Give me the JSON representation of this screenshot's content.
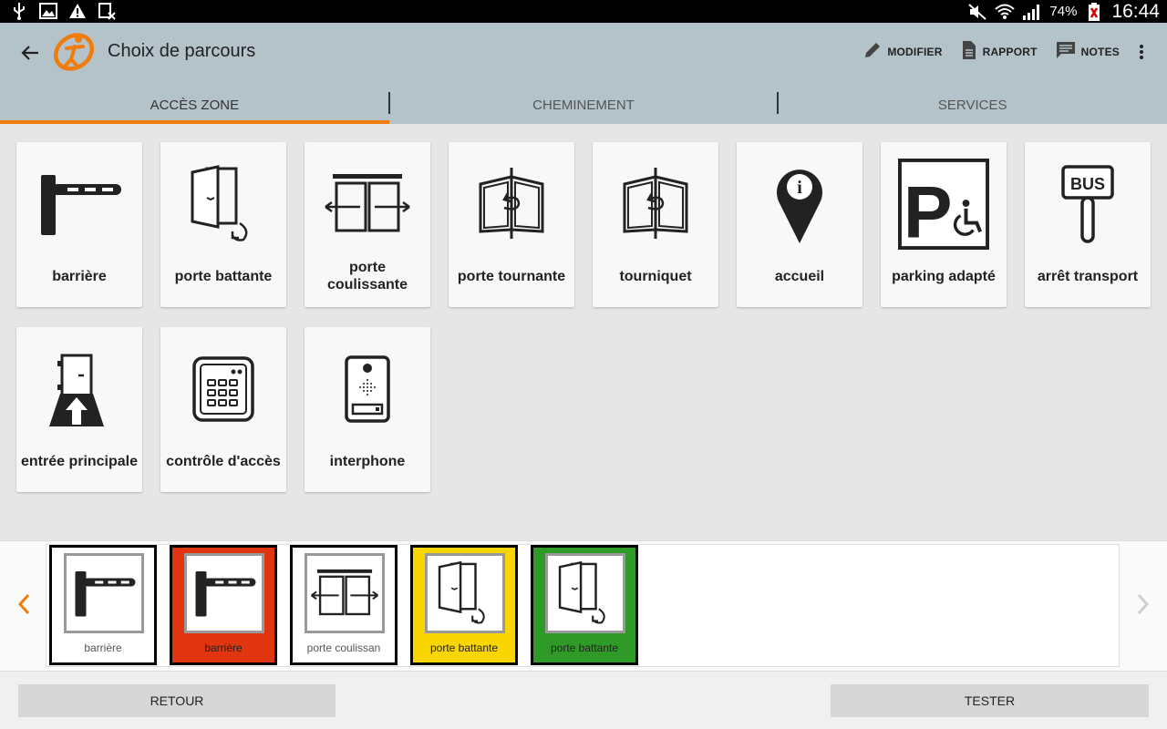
{
  "status_bar": {
    "left_icons": [
      "usb-icon",
      "image-icon",
      "warning-icon",
      "sim-icon"
    ],
    "right_icons": [
      "mute-icon",
      "wifi-icon",
      "signal-icon",
      "battery-icon"
    ],
    "battery": "74%",
    "time": "16:44"
  },
  "header": {
    "title": "Choix de parcours",
    "actions": [
      {
        "label": "MODIFIER",
        "icon": "pencil-icon"
      },
      {
        "label": "RAPPORT",
        "icon": "document-icon"
      },
      {
        "label": "NOTES",
        "icon": "notes-icon"
      }
    ]
  },
  "tabs": [
    {
      "label": "ACCÈS ZONE",
      "active": true
    },
    {
      "label": "CHEMINEMENT",
      "active": false
    },
    {
      "label": "SERVICES",
      "active": false
    }
  ],
  "cards": [
    {
      "label": "barrière",
      "icon": "barrier-icon"
    },
    {
      "label": "porte battante",
      "icon": "swing-door-icon"
    },
    {
      "label": "porte coulissante",
      "icon": "sliding-door-icon"
    },
    {
      "label": "porte tournante",
      "icon": "revolving-door-icon"
    },
    {
      "label": "tourniquet",
      "icon": "turnstile-icon"
    },
    {
      "label": "accueil",
      "icon": "info-pin-icon"
    },
    {
      "label": "parking adapté",
      "icon": "accessible-parking-icon"
    },
    {
      "label": "arrêt transport",
      "icon": "bus-stop-icon"
    },
    {
      "label": "entrée principale",
      "icon": "main-entrance-icon"
    },
    {
      "label": "contrôle d'accès",
      "icon": "keypad-icon"
    },
    {
      "label": "interphone",
      "icon": "intercom-icon"
    }
  ],
  "strip": {
    "tiles": [
      {
        "label": "barrière",
        "icon": "barrier-icon",
        "color": "#ffffff"
      },
      {
        "label": "barrière",
        "icon": "barrier-icon",
        "color": "#e0350f"
      },
      {
        "label": "porte coulissan",
        "icon": "sliding-door-icon",
        "color": "#ffffff"
      },
      {
        "label": "porte battante",
        "icon": "swing-door-icon",
        "color": "#f9d602"
      },
      {
        "label": "porte battante",
        "icon": "swing-door-icon",
        "color": "#2f9a28"
      }
    ]
  },
  "footer": {
    "back_label": "RETOUR",
    "test_label": "TESTER"
  },
  "colors": {
    "accent": "#f07c0c",
    "appbar": "#b4c3ca"
  }
}
